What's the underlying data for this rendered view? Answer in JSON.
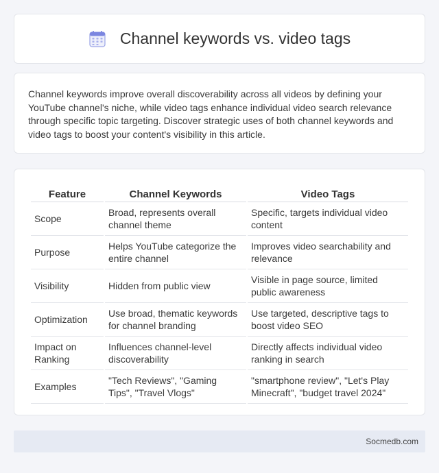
{
  "header": {
    "title": "Channel keywords vs. video tags",
    "icon": "calendar-icon",
    "icon_color": "#7b86e0"
  },
  "intro": {
    "text": "Channel keywords improve overall discoverability across all videos by defining your YouTube channel's niche, while video tags enhance individual video search relevance through specific topic targeting. Discover strategic uses of both channel keywords and video tags to boost your content's visibility in this article."
  },
  "table": {
    "headers": [
      "Feature",
      "Channel Keywords",
      "Video Tags"
    ],
    "rows": [
      [
        "Scope",
        "Broad, represents overall channel theme",
        "Specific, targets individual video content"
      ],
      [
        "Purpose",
        "Helps YouTube categorize the entire channel",
        "Improves video searchability and relevance"
      ],
      [
        "Visibility",
        "Hidden from public view",
        "Visible in page source, limited public awareness"
      ],
      [
        "Optimization",
        "Use broad, thematic keywords for channel branding",
        "Use targeted, descriptive tags to boost video SEO"
      ],
      [
        "Impact on Ranking",
        "Influences channel-level discoverability",
        "Directly affects individual video ranking in search"
      ],
      [
        "Examples",
        "\"Tech Reviews\", \"Gaming Tips\", \"Travel Vlogs\"",
        "\"smartphone review\", \"Let's Play Minecraft\", \"budget travel 2024\""
      ]
    ]
  },
  "footer": {
    "source": "Socmedb.com"
  }
}
